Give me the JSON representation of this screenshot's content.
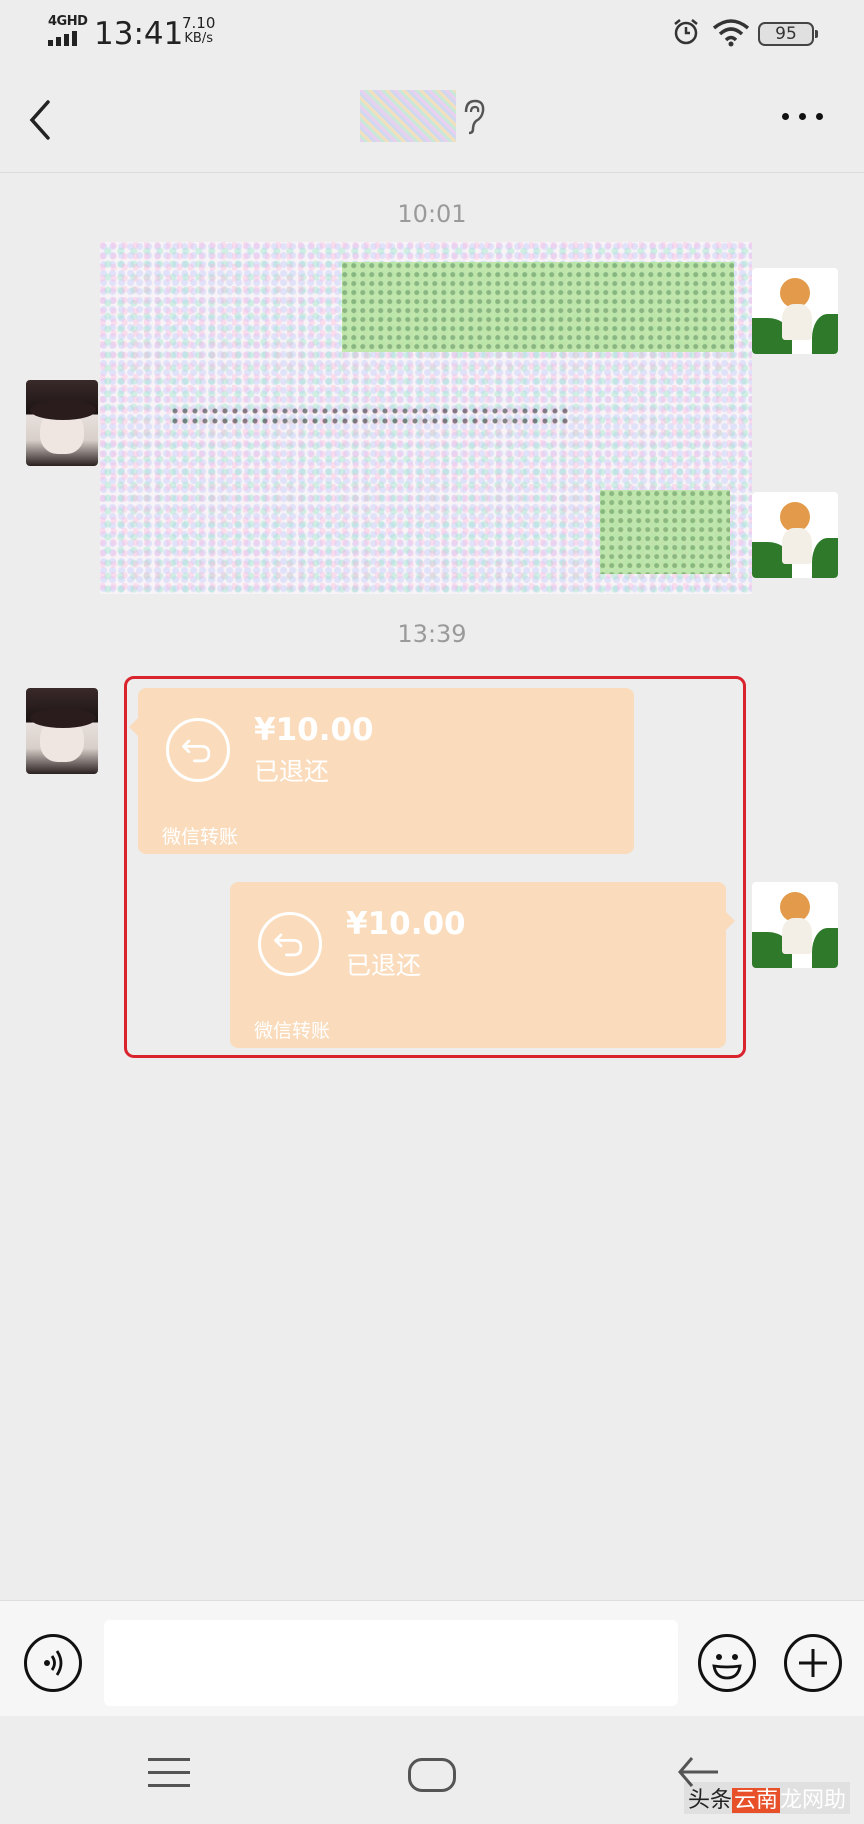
{
  "status_bar": {
    "network": "4GHD",
    "time": "13:41",
    "speed_value": "7.10",
    "speed_unit": "KB/s",
    "battery": "95"
  },
  "header": {
    "contact_name": "",
    "icons": [
      "back-arrow-icon",
      "ear-icon",
      "more-dots-icon"
    ]
  },
  "chat": {
    "timestamp_1": "10:01",
    "timestamp_2": "13:39",
    "transfers": [
      {
        "side": "left",
        "amount": "¥10.00",
        "status": "已退还",
        "footer": "微信转账"
      },
      {
        "side": "right",
        "amount": "¥10.00",
        "status": "已退还",
        "footer": "微信转账"
      }
    ]
  },
  "input_bar": {
    "text_value": "",
    "icons": [
      "voice-icon",
      "emoji-icon",
      "plus-icon"
    ]
  },
  "nav_bar": {
    "icons": [
      "menu-icon",
      "home-icon",
      "back-icon"
    ]
  },
  "watermark": {
    "part1": "头条",
    "part2": "云南",
    "part3": "龙网",
    "part4": "助"
  },
  "colors": {
    "background": "#ededed",
    "transfer_card": "#fadcbd",
    "highlight_box": "#d9242e"
  }
}
